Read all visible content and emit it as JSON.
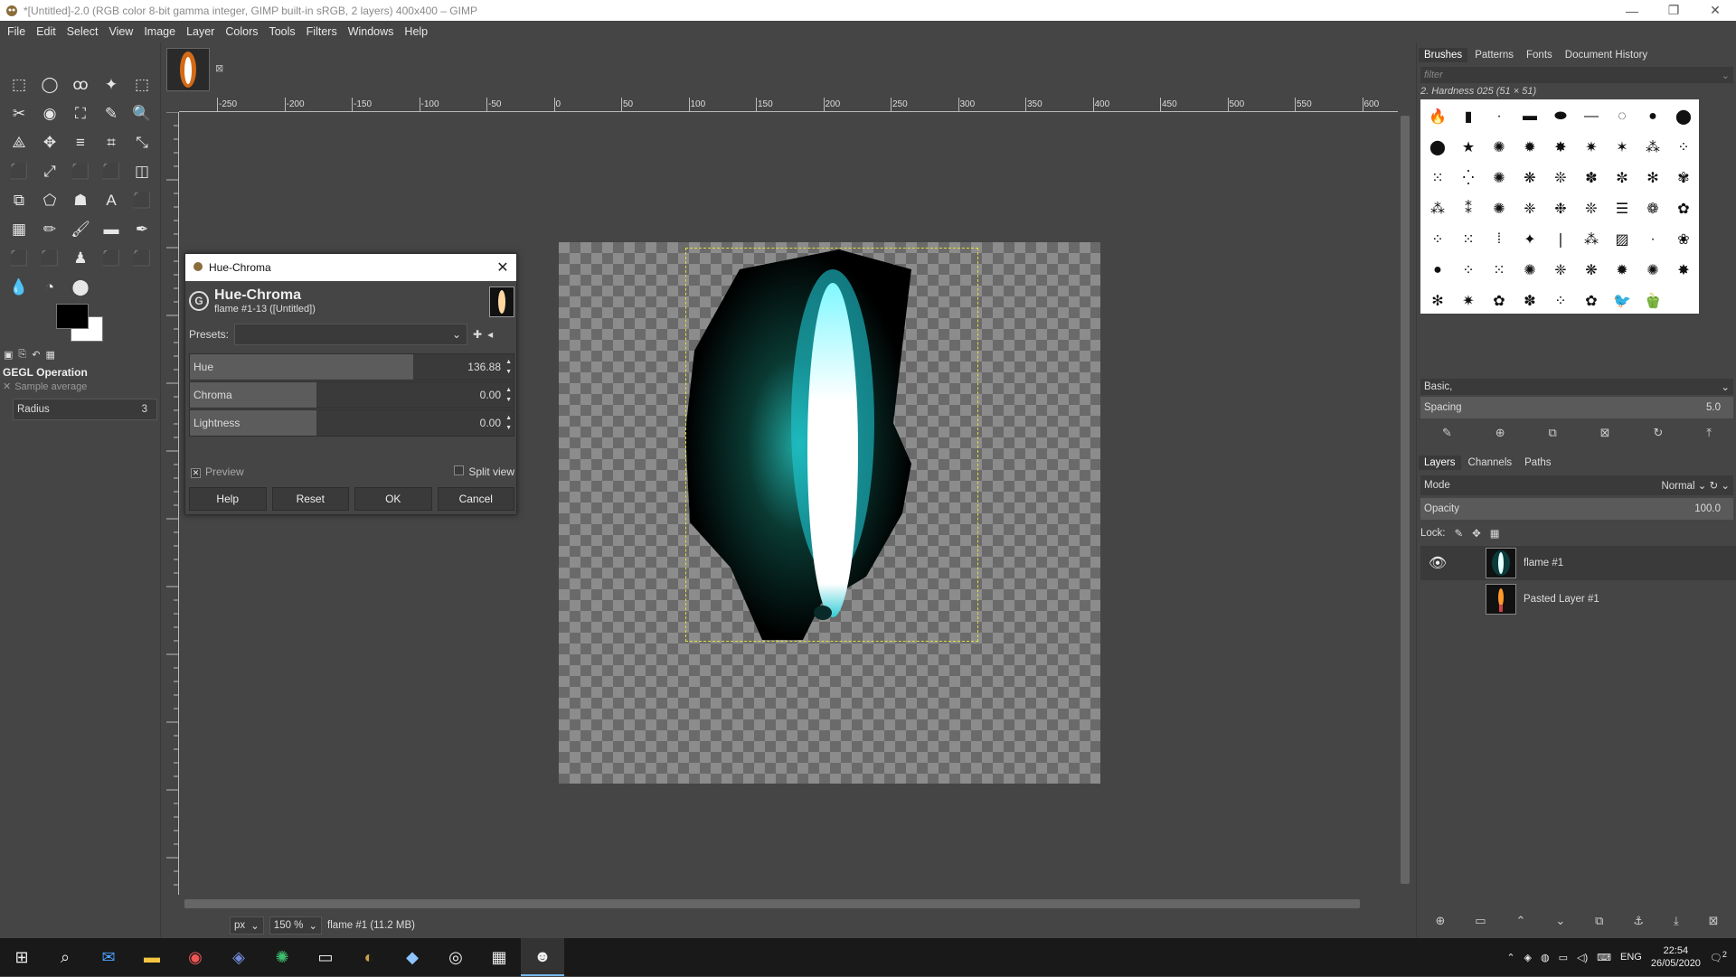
{
  "window": {
    "title": "*[Untitled]-2.0 (RGB color 8-bit gamma integer, GIMP built-in sRGB, 2 layers) 400x400 – GIMP",
    "minimize": "—",
    "maximize": "❐",
    "close": "✕"
  },
  "menu": [
    "File",
    "Edit",
    "Select",
    "View",
    "Image",
    "Layer",
    "Colors",
    "Tools",
    "Filters",
    "Windows",
    "Help"
  ],
  "toolbox": {
    "tools": [
      "⬚",
      "◯",
      "ꝏ",
      "✦",
      "⬚",
      "✂",
      "◉",
      "⛶",
      "✎",
      "🔍",
      "⟁",
      "✥",
      "≡",
      "⌗",
      "⤡",
      "⬛",
      "⤢",
      "⬛",
      "⬛",
      "◫",
      "⧉",
      "⬠",
      "☗",
      "A",
      "⬛",
      "▦",
      "✏",
      "🖌",
      "▬",
      "✒",
      "⬛",
      "⬛",
      "♟",
      "⬛",
      "⬛",
      "💧",
      "◔",
      "⬤"
    ],
    "options_title": "GEGL Operation",
    "sample_average": "Sample average",
    "radius_label": "Radius",
    "radius_value": "3"
  },
  "image_tab": {
    "close": "⊠"
  },
  "ruler": {
    "h_ticks": [
      "-250",
      "-200",
      "-150",
      "-100",
      "-50",
      "0",
      "50",
      "100",
      "150",
      "200",
      "250",
      "300",
      "350",
      "400",
      "450",
      "500",
      "550",
      "600"
    ]
  },
  "status": {
    "unit": "px",
    "zoom": "150 %",
    "layer_info": "flame #1 (11.2 MB)"
  },
  "dock": {
    "tabs": [
      "Brushes",
      "Patterns",
      "Fonts",
      "Document History"
    ],
    "filter_placeholder": "filter",
    "brush_name": "2. Hardness 025 (51 × 51)",
    "basic": "Basic,",
    "spacing_label": "Spacing",
    "spacing_value": "5.0"
  },
  "layers": {
    "tabs": [
      "Layers",
      "Channels",
      "Paths"
    ],
    "mode_label": "Mode",
    "mode_value": "Normal",
    "opacity_label": "Opacity",
    "opacity_value": "100.0",
    "lock_label": "Lock:",
    "items": [
      {
        "name": "flame #1",
        "visible": true,
        "selected": true
      },
      {
        "name": "Pasted Layer #1",
        "visible": false,
        "selected": false
      }
    ]
  },
  "dialog": {
    "title": "Hue-Chroma",
    "heading": "Hue-Chroma",
    "subheading": "flame #1-13 ([Untitled])",
    "presets_label": "Presets:",
    "sliders": [
      {
        "label": "Hue",
        "value": "136.88",
        "fill": 0.69
      },
      {
        "label": "Chroma",
        "value": "0.00",
        "fill": 0.39
      },
      {
        "label": "Lightness",
        "value": "0.00",
        "fill": 0.39
      }
    ],
    "preview_label": "Preview",
    "split_view_label": "Split view",
    "buttons": [
      "Help",
      "Reset",
      "OK",
      "Cancel"
    ]
  },
  "taskbar": {
    "language": "ENG",
    "time": "22:54",
    "date": "26/05/2020",
    "notifications": "2"
  }
}
